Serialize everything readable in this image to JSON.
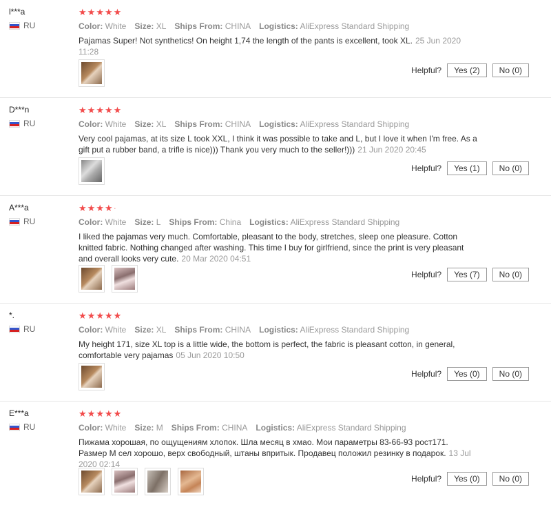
{
  "labels": {
    "color": "Color:",
    "size": "Size:",
    "ships_from": "Ships From:",
    "logistics": "Logistics:",
    "helpful": "Helpful?"
  },
  "colors": {
    "star": "#f24b4b",
    "border": "#e6e6e6"
  },
  "reviews": [
    {
      "user": "l***a",
      "country": "RU",
      "rating": 5,
      "color": "White",
      "size": "XL",
      "ships_from": "CHINA",
      "logistics": "AliExpress Standard Shipping",
      "text": "Pajamas Super! Not synthetics! On height 1,74 the length of the pants is excellent, took XL.",
      "date": "25 Jun 2020 11:28",
      "photos": [
        "photo-1"
      ],
      "yes": "Yes (2)",
      "no": "No (0)"
    },
    {
      "user": "D***n",
      "country": "RU",
      "rating": 5,
      "color": "White",
      "size": "XL",
      "ships_from": "CHINA",
      "logistics": "AliExpress Standard Shipping",
      "text": "Very cool pajamas, at its size L took XXL, I think it was possible to take and L, but I love it when I'm free. As a gift put a rubber band, a trifle is nice))) Thank you very much to the seller!)))",
      "date": "21 Jun 2020 20:45",
      "photos": [
        "photo-1"
      ],
      "yes": "Yes (1)",
      "no": "No (0)"
    },
    {
      "user": "A***a",
      "country": "RU",
      "rating": 4.5,
      "color": "White",
      "size": "L",
      "ships_from": "China",
      "logistics": "AliExpress Standard Shipping",
      "text": "I liked the pajamas very much. Comfortable, pleasant to the body, stretches, sleep one pleasure. Cotton knitted fabric. Nothing changed after washing. This time I buy for girlfriend, since the print is very pleasant and overall looks very cute.",
      "date": "20 Mar 2020 04:51",
      "photos": [
        "photo-1",
        "photo-2"
      ],
      "yes": "Yes (7)",
      "no": "No (0)"
    },
    {
      "user": "*.",
      "country": "RU",
      "rating": 5,
      "color": "White",
      "size": "XL",
      "ships_from": "CHINA",
      "logistics": "AliExpress Standard Shipping",
      "text": "My height 171, size XL top is a little wide, the bottom is perfect, the fabric is pleasant cotton, in general, comfortable very pajamas",
      "date": "05 Jun 2020 10:50",
      "photos": [
        "photo-1"
      ],
      "yes": "Yes (0)",
      "no": "No (0)"
    },
    {
      "user": "E***a",
      "country": "RU",
      "rating": 5,
      "color": "White",
      "size": "M",
      "ships_from": "CHINA",
      "logistics": "AliExpress Standard Shipping",
      "text": "Пижама хорошая, по ощущениям хлопок. Шла месяц в хмао. Мои параметры 83-66-93 рост171. Размер М сел хорошо, верх свободный, штаны впритык. Продавец положил резинку в подарок.",
      "date": "13 Jul 2020 02:14",
      "photos": [
        "photo-1",
        "photo-2",
        "photo-3",
        "photo-4"
      ],
      "yes": "Yes (0)",
      "no": "No (0)"
    }
  ]
}
